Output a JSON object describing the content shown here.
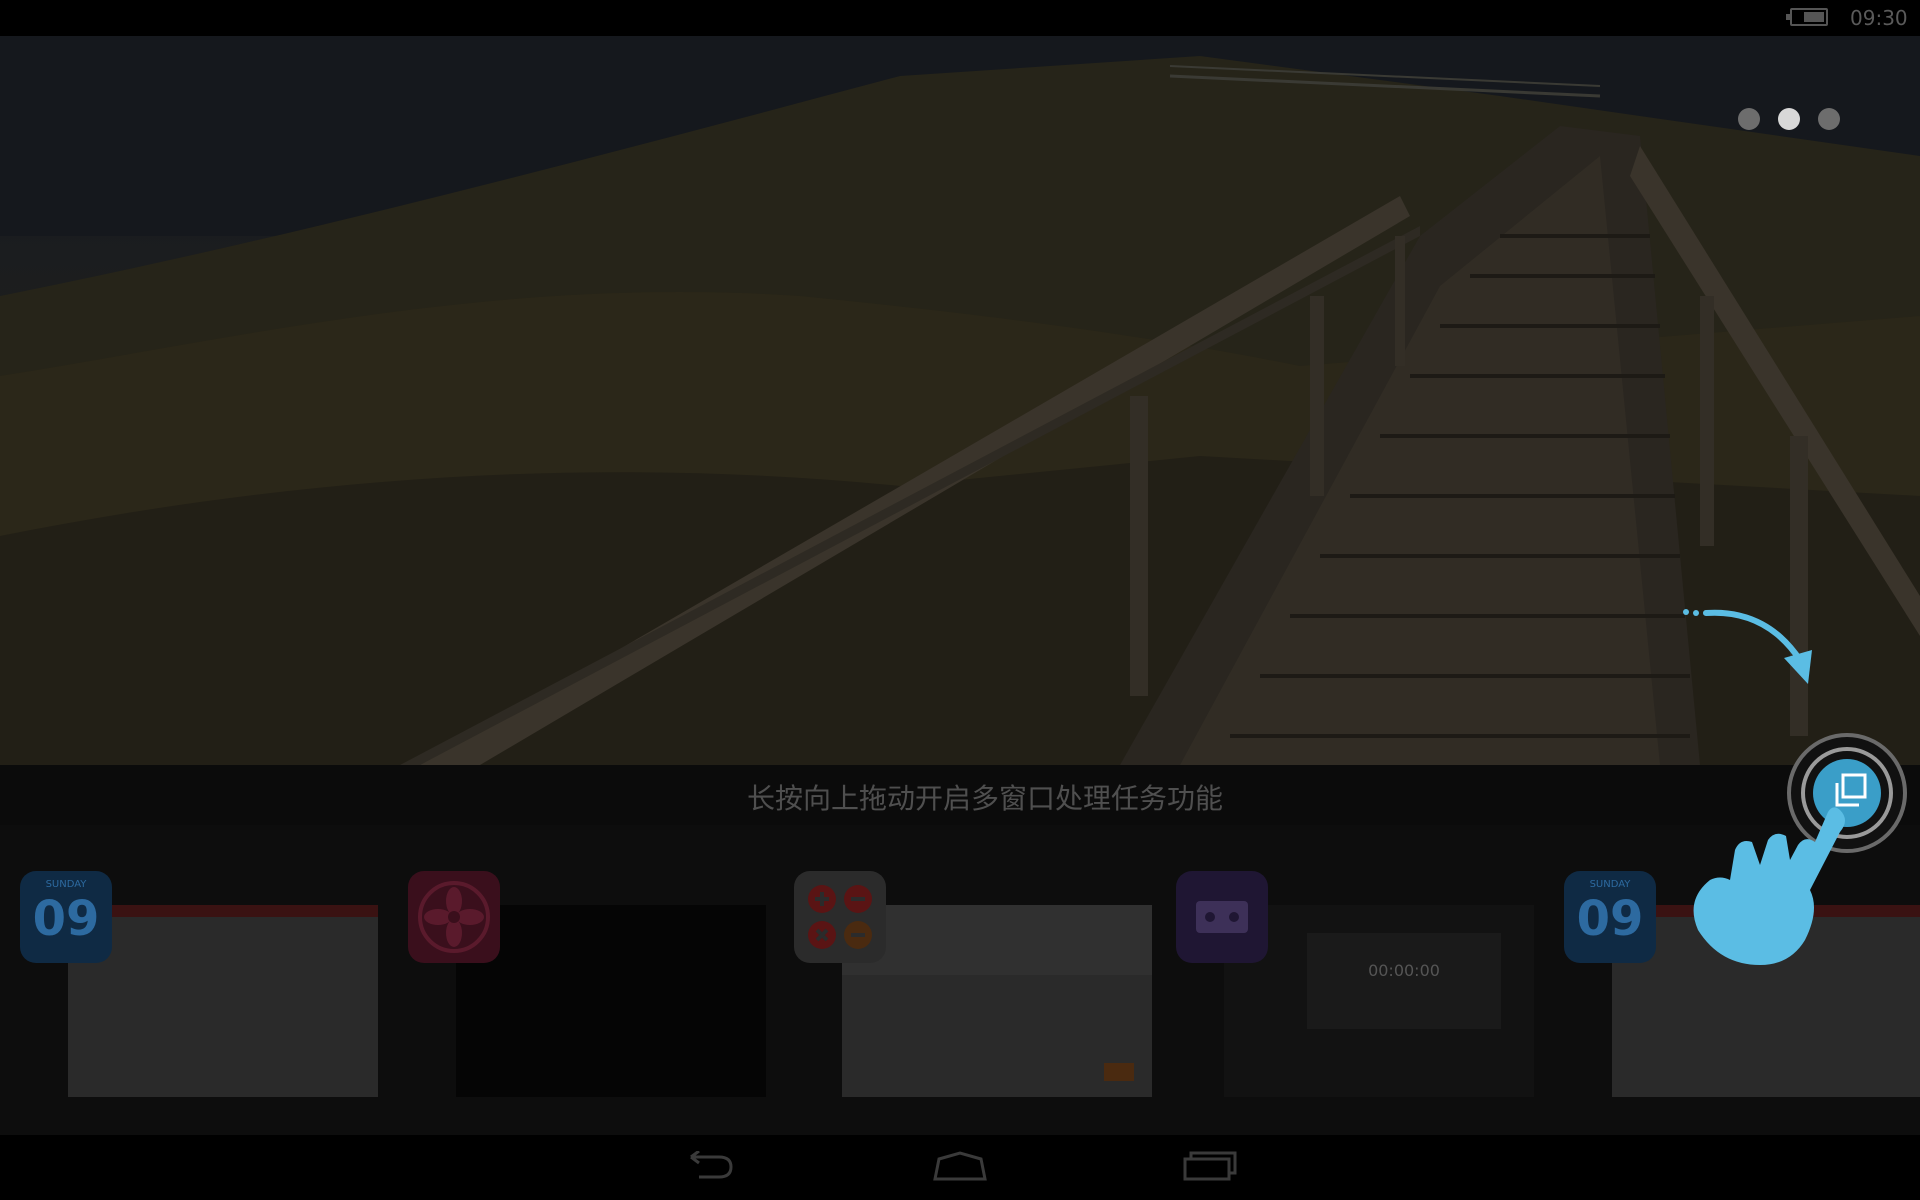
{
  "status_bar": {
    "time": "09:30"
  },
  "pager": {
    "pages": 3,
    "active_index": 1
  },
  "hint": {
    "text": "长按向上拖动开启多窗口处理任务功能"
  },
  "recent_apps": [
    {
      "name": "calendar",
      "icon": "calendar-icon",
      "day_label": "SUNDAY",
      "day_number": "09"
    },
    {
      "name": "flower-app",
      "icon": "flower-icon"
    },
    {
      "name": "calculator",
      "icon": "calculator-icon"
    },
    {
      "name": "recorder",
      "icon": "recorder-icon",
      "timer": "00:00:00"
    },
    {
      "name": "calendar",
      "icon": "calendar-icon",
      "day_label": "SUNDAY",
      "day_number": "09"
    }
  ],
  "nav": {
    "back": "back-icon",
    "home": "home-icon",
    "recents": "recents-icon"
  },
  "colors": {
    "accent": "#5bbde4",
    "hint_text": "#4f4f4f"
  }
}
